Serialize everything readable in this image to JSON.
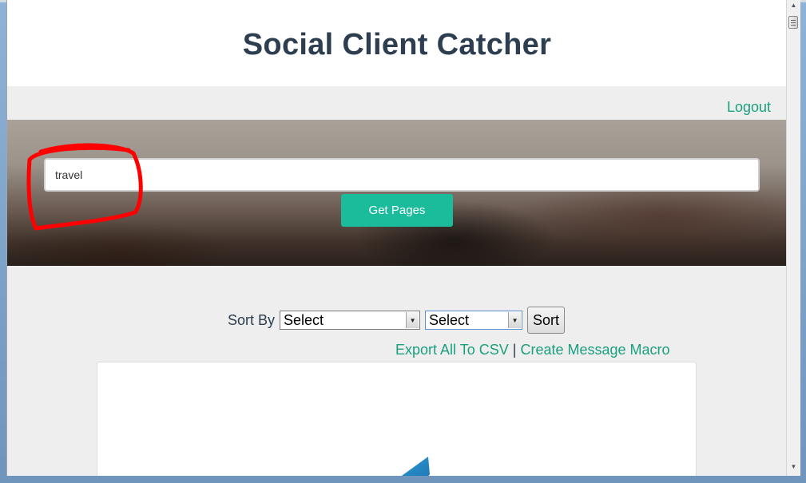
{
  "header": {
    "title": "Social Client Catcher"
  },
  "nav": {
    "logout_label": "Logout"
  },
  "search": {
    "value": "travel",
    "button_label": "Get Pages"
  },
  "sort": {
    "label": "Sort By",
    "field_select": "Select",
    "order_select": "Select",
    "button_label": "Sort"
  },
  "actions": {
    "export_label": "Export All To CSV",
    "separator": "|",
    "macro_label": "Create Message Macro"
  },
  "colors": {
    "title": "#2c3e50",
    "accent": "#1abc9c",
    "link": "#1a9f7f",
    "annotation": "#ff0000"
  }
}
